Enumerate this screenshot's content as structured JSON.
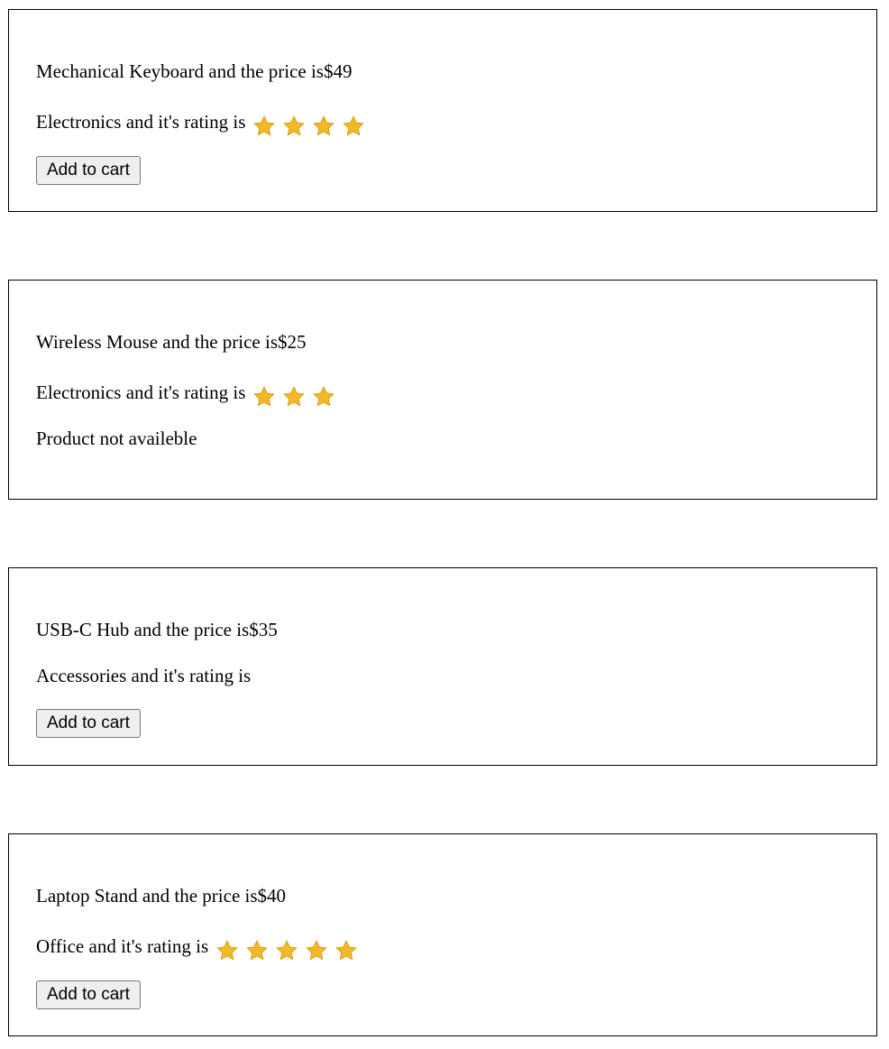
{
  "products": [
    {
      "title": "Mechanical Keyboard and the price is$49",
      "category_rating": "Electronics and it's rating is",
      "rating": 4,
      "action_label": "Add to cart"
    },
    {
      "title": "Wireless Mouse and the price is$25",
      "category_rating": "Electronics and it's rating is",
      "rating": 3,
      "unavailable_text": "Product not availeble"
    },
    {
      "title": "USB-C Hub and the price is$35",
      "category_rating": "Accessories and it's rating is",
      "rating": 0,
      "action_label": "Add to cart"
    },
    {
      "title": "Laptop Stand and the price is$40",
      "category_rating": "Office and it's rating is",
      "rating": 5,
      "action_label": "Add to cart"
    }
  ],
  "colors": {
    "star": "#f2b927",
    "star_edge": "#d99a16"
  },
  "icons": {
    "rating_star": "star-icon"
  }
}
